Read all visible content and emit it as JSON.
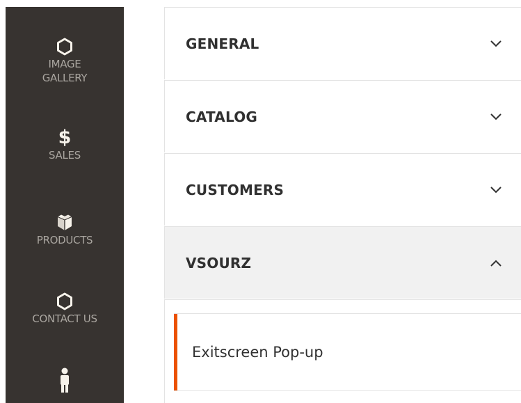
{
  "sidebar": {
    "items": [
      {
        "label": "IMAGE\nGALLERY",
        "icon": "hexagon-icon"
      },
      {
        "label": "SALES",
        "icon": "dollar-icon",
        "icon_glyph": "$"
      },
      {
        "label": "PRODUCTS",
        "icon": "box-icon"
      },
      {
        "label": "CONTACT US",
        "icon": "hexagon-icon"
      },
      {
        "label": "",
        "icon": "person-icon"
      }
    ]
  },
  "config": {
    "sections": [
      {
        "title": "GENERAL",
        "state": "collapsed"
      },
      {
        "title": "CATALOG",
        "state": "collapsed"
      },
      {
        "title": "CUSTOMERS",
        "state": "collapsed"
      },
      {
        "title": "VSOURZ",
        "state": "expanded"
      }
    ],
    "vsourz_items": [
      {
        "label": "Exitscreen Pop-up",
        "active": true
      }
    ]
  },
  "colors": {
    "sidebar_bg": "#373330",
    "sidebar_text": "#aaa6a0",
    "accent": "#eb5202",
    "expanded_bg": "#f1f1f1",
    "text": "#303030"
  }
}
